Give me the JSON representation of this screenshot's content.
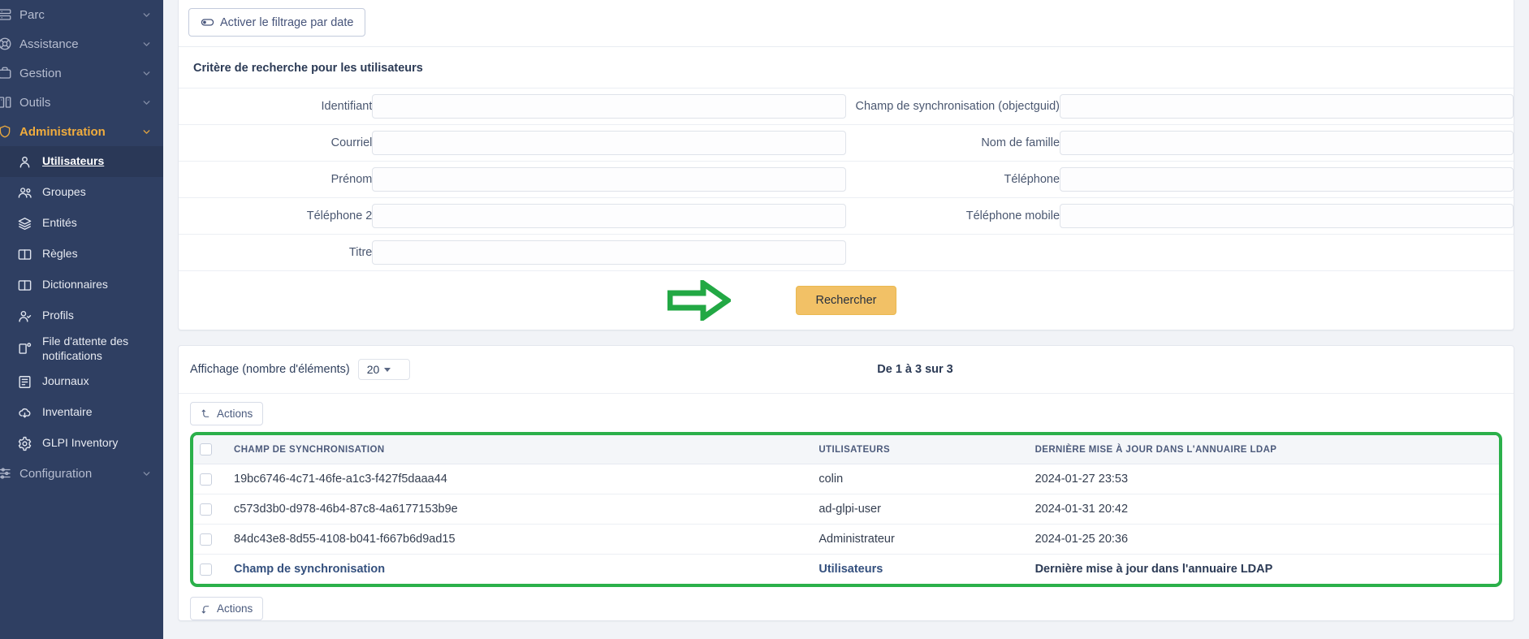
{
  "sidebar": {
    "top_items": [
      {
        "label": "Parc",
        "icon": "server-icon",
        "active": false
      },
      {
        "label": "Assistance",
        "icon": "lifebuoy-icon",
        "active": false
      },
      {
        "label": "Gestion",
        "icon": "briefcase-icon",
        "active": false
      },
      {
        "label": "Outils",
        "icon": "tools-icon",
        "active": false
      },
      {
        "label": "Administration",
        "icon": "shield-icon",
        "active": true
      }
    ],
    "sub_items": [
      {
        "label": "Utilisateurs",
        "icon": "user-icon",
        "current": true
      },
      {
        "label": "Groupes",
        "icon": "users-icon",
        "current": false
      },
      {
        "label": "Entités",
        "icon": "layers-icon",
        "current": false
      },
      {
        "label": "Règles",
        "icon": "book-icon",
        "current": false
      },
      {
        "label": "Dictionnaires",
        "icon": "book-icon",
        "current": false
      },
      {
        "label": "Profils",
        "icon": "user-check-icon",
        "current": false
      },
      {
        "label": "File d'attente des notifications",
        "icon": "mail-queue-icon",
        "current": false
      },
      {
        "label": "Journaux",
        "icon": "list-details-icon",
        "current": false
      },
      {
        "label": "Inventaire",
        "icon": "cloud-download-icon",
        "current": false
      },
      {
        "label": "GLPI Inventory",
        "icon": "gear-icon",
        "current": false
      }
    ],
    "bottom_items": [
      {
        "label": "Configuration",
        "icon": "sliders-icon",
        "active": false
      }
    ]
  },
  "filter": {
    "toggle_label": "Activer le filtrage par date",
    "toggle_icon": "toggle-off-icon"
  },
  "search_form": {
    "title": "Critère de recherche pour les utilisateurs",
    "rows": [
      {
        "left": {
          "label": "Identifiant",
          "value": "",
          "placeholder": ""
        },
        "right": {
          "label": "Champ de synchronisation (objectguid)",
          "value": "",
          "placeholder": ""
        }
      },
      {
        "left": {
          "label": "Courriel",
          "value": "",
          "placeholder": ""
        },
        "right": {
          "label": "Nom de famille",
          "value": "",
          "placeholder": ""
        }
      },
      {
        "left": {
          "label": "Prénom",
          "value": "",
          "placeholder": ""
        },
        "right": {
          "label": "Téléphone",
          "value": "",
          "placeholder": ""
        }
      },
      {
        "left": {
          "label": "Téléphone 2",
          "value": "",
          "placeholder": ""
        },
        "right": {
          "label": "Téléphone mobile",
          "value": "",
          "placeholder": ""
        }
      },
      {
        "left": {
          "label": "Titre",
          "value": "",
          "placeholder": ""
        },
        "right": {
          "label": "",
          "value": null,
          "placeholder": ""
        }
      }
    ],
    "submit_label": "Rechercher",
    "submit_color": "#f2c166",
    "annotation_arrow": {
      "name": "green-arrow-annotation",
      "color": "#22a844"
    }
  },
  "results": {
    "display_label": "Affichage (nombre d'éléments)",
    "page_size": "20",
    "range_info": "De 1 à 3 sur 3",
    "actions_label": "Actions",
    "actions_bottom_label": "Actions",
    "highlight_color": "#2bb04a",
    "columns": [
      "Champ de synchronisation",
      "Utilisateurs",
      "Dernière mise à jour dans l'annuaire LDAP"
    ],
    "rows": [
      {
        "sync_field": "19bc6746-4c71-46fe-a1c3-f427f5daaa44",
        "user": "colin",
        "last_update": "2024-01-27 23:53"
      },
      {
        "sync_field": "c573d3b0-d978-46b4-87c8-4a6177153b9e",
        "user": "ad-glpi-user",
        "last_update": "2024-01-31 20:42"
      },
      {
        "sync_field": "84dc43e8-8d55-4108-b041-f667b6d9ad15",
        "user": "Administrateur",
        "last_update": "2024-01-25 20:36"
      }
    ],
    "footer": {
      "sync_field": "Champ de synchronisation",
      "user": "Utilisateurs",
      "last_update": "Dernière mise à jour dans l'annuaire LDAP"
    }
  }
}
